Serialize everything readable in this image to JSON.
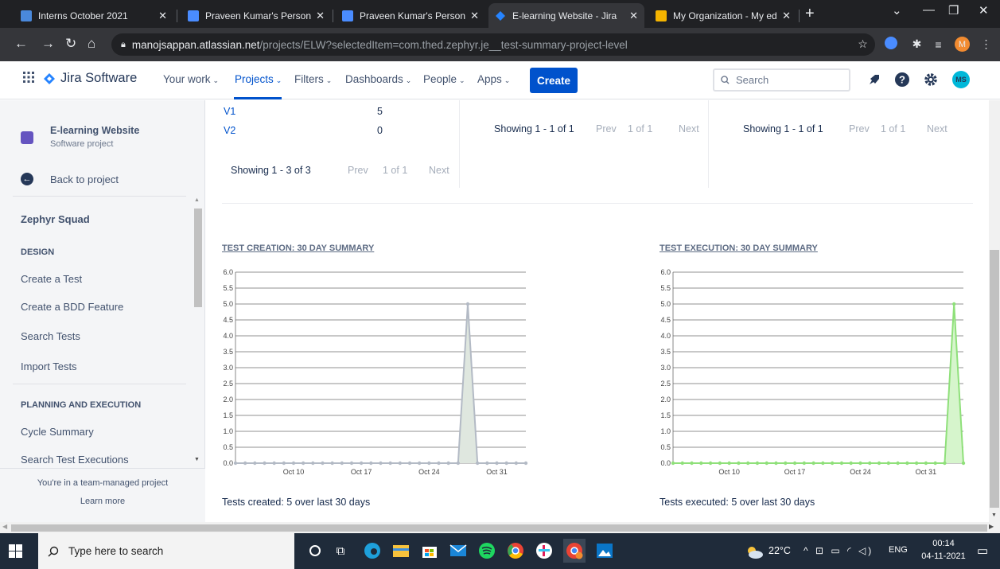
{
  "browser": {
    "tabs": [
      {
        "title": "Interns October 2021",
        "active": false
      },
      {
        "title": "Praveen Kumar's Personal Me",
        "active": false
      },
      {
        "title": "Praveen Kumar's Personal Me",
        "active": false
      },
      {
        "title": "E-learning Website - Jira",
        "active": true
      },
      {
        "title": "My Organization - My educa",
        "active": false
      }
    ],
    "new_tab": "+",
    "url_host": "manojsappan.atlassian.net",
    "url_path": "/projects/ELW?selectedItem=com.thed.zephyr.je__test-summary-project-level",
    "profile_initial": "M"
  },
  "jira_nav": {
    "product_name": "Jira Software",
    "items": [
      {
        "label": "Your work",
        "chevron": "⌄"
      },
      {
        "label": "Projects",
        "chevron": "⌄"
      },
      {
        "label": "Filters",
        "chevron": "⌄"
      },
      {
        "label": "Dashboards",
        "chevron": "⌄"
      },
      {
        "label": "People",
        "chevron": "⌄"
      },
      {
        "label": "Apps",
        "chevron": "⌄"
      }
    ],
    "create_label": "Create",
    "search_placeholder": "Search",
    "avatar_initials": "MS"
  },
  "sidebar": {
    "project_name": "E-learning Website",
    "project_type": "Software project",
    "back_label": "Back to project",
    "section_title": "Zephyr Squad",
    "design_heading": "DESIGN",
    "design_links": [
      "Create a Test",
      "Create a BDD Feature",
      "Search Tests",
      "Import Tests"
    ],
    "planning_heading": "PLANNING AND EXECUTION",
    "planning_links": [
      "Cycle Summary",
      "Search Test Executions"
    ],
    "team_note": "You're in a team-managed project",
    "learn_more": "Learn more"
  },
  "versions": {
    "rows": [
      {
        "name": "V1",
        "count": "5"
      },
      {
        "name": "V2",
        "count": "0"
      }
    ],
    "pager": {
      "showing": "Showing 1 - 3 of 3",
      "prev": "Prev",
      "of": "1 of 1",
      "next": "Next"
    }
  },
  "pager_mid": {
    "showing": "Showing 1 - 1 of 1",
    "prev": "Prev",
    "of": "1 of 1",
    "next": "Next"
  },
  "pager_right": {
    "showing": "Showing 1 - 1 of 1",
    "prev": "Prev",
    "of": "1 of 1",
    "next": "Next"
  },
  "chart_data": [
    {
      "type": "area",
      "title": "TEST CREATION: 30 DAY SUMMARY",
      "x": [
        "Oct 4",
        "Oct 5",
        "Oct 6",
        "Oct 7",
        "Oct 8",
        "Oct 9",
        "Oct 10",
        "Oct 11",
        "Oct 12",
        "Oct 13",
        "Oct 14",
        "Oct 15",
        "Oct 16",
        "Oct 17",
        "Oct 18",
        "Oct 19",
        "Oct 20",
        "Oct 21",
        "Oct 22",
        "Oct 23",
        "Oct 24",
        "Oct 25",
        "Oct 26",
        "Oct 27",
        "Oct 28",
        "Oct 29",
        "Oct 30",
        "Oct 31",
        "Nov 1",
        "Nov 2",
        "Nov 3"
      ],
      "values": [
        0,
        0,
        0,
        0,
        0,
        0,
        0,
        0,
        0,
        0,
        0,
        0,
        0,
        0,
        0,
        0,
        0,
        0,
        0,
        0,
        0,
        0,
        0,
        0,
        5,
        0,
        0,
        0,
        0,
        0,
        0
      ],
      "x_tick_labels": [
        "Oct 10",
        "Oct 17",
        "Oct 24",
        "Oct 31"
      ],
      "x_tick_indices": [
        6,
        13,
        20,
        27
      ],
      "y_ticks": [
        "0.0",
        "0.5",
        "1.0",
        "1.5",
        "2.0",
        "2.5",
        "3.0",
        "3.5",
        "4.0",
        "4.5",
        "5.0",
        "5.5",
        "6.0"
      ],
      "ylim": [
        0,
        6
      ],
      "grid": true,
      "color": "#b3bac5",
      "fill": "#dfe7df",
      "summary": "Tests created: 5 over last 30 days"
    },
    {
      "type": "area",
      "title": "TEST EXECUTION: 30 DAY SUMMARY",
      "x": [
        "Oct 4",
        "Oct 5",
        "Oct 6",
        "Oct 7",
        "Oct 8",
        "Oct 9",
        "Oct 10",
        "Oct 11",
        "Oct 12",
        "Oct 13",
        "Oct 14",
        "Oct 15",
        "Oct 16",
        "Oct 17",
        "Oct 18",
        "Oct 19",
        "Oct 20",
        "Oct 21",
        "Oct 22",
        "Oct 23",
        "Oct 24",
        "Oct 25",
        "Oct 26",
        "Oct 27",
        "Oct 28",
        "Oct 29",
        "Oct 30",
        "Oct 31",
        "Nov 1",
        "Nov 2",
        "Nov 3",
        "Nov 4"
      ],
      "values": [
        0,
        0,
        0,
        0,
        0,
        0,
        0,
        0,
        0,
        0,
        0,
        0,
        0,
        0,
        0,
        0,
        0,
        0,
        0,
        0,
        0,
        0,
        0,
        0,
        0,
        0,
        0,
        0,
        0,
        0,
        5,
        0
      ],
      "x_tick_labels": [
        "Oct 10",
        "Oct 17",
        "Oct 24",
        "Oct 31"
      ],
      "x_tick_indices": [
        6,
        13,
        20,
        27
      ],
      "y_ticks": [
        "0.0",
        "0.5",
        "1.0",
        "1.5",
        "2.0",
        "2.5",
        "3.0",
        "3.5",
        "4.0",
        "4.5",
        "5.0",
        "5.5",
        "6.0"
      ],
      "ylim": [
        0,
        6
      ],
      "grid": true,
      "color": "#8fe07a",
      "fill": "#d6f5cc",
      "summary": "Tests executed: 5 over last 30 days"
    }
  ],
  "taskbar": {
    "search_placeholder": "Type here to search",
    "temperature": "22°C",
    "language": "ENG",
    "time": "00:14",
    "date": "04-11-2021"
  },
  "colors": {
    "jira_blue": "#0052cc",
    "sidebar_bg": "#f4f5f7"
  }
}
